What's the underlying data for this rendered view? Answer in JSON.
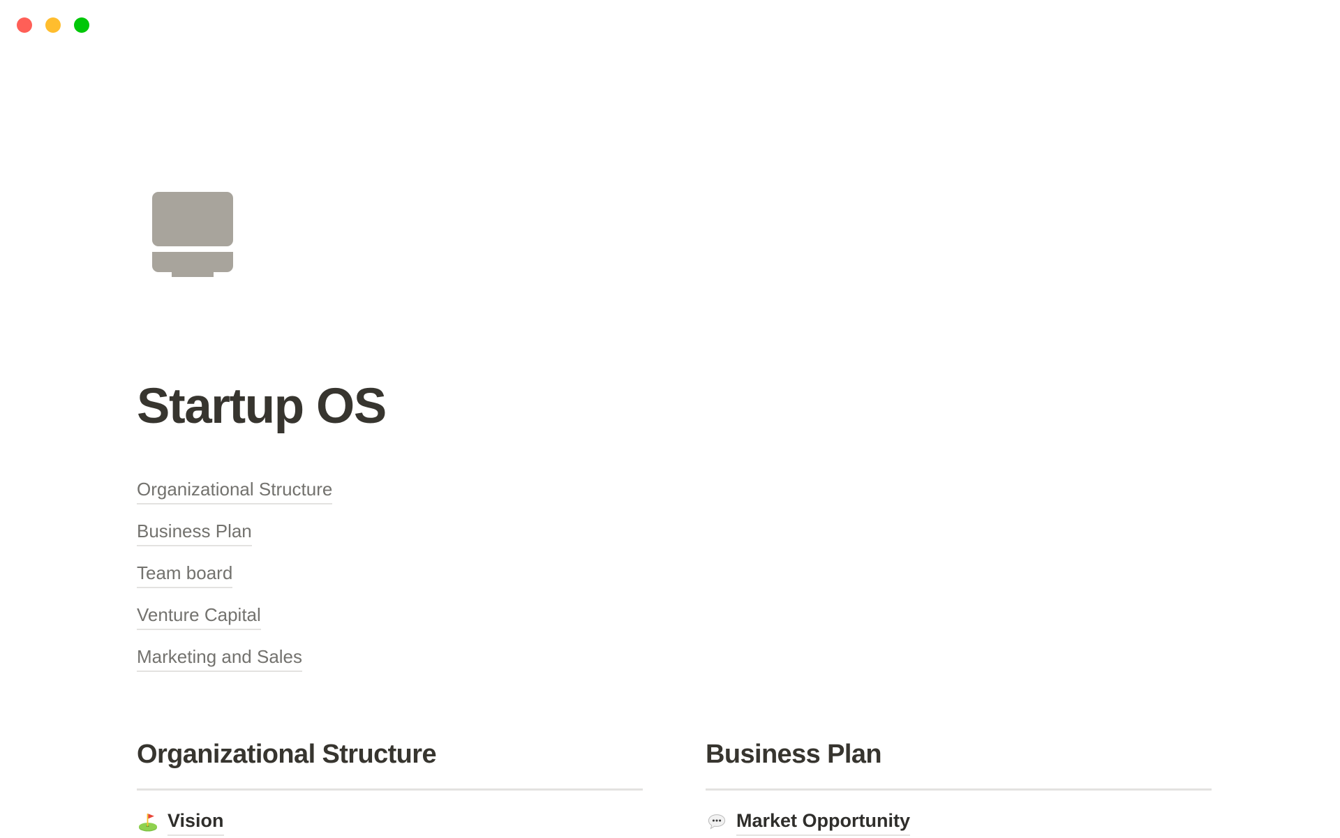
{
  "window": {
    "controls": [
      {
        "name": "close",
        "label": "Close",
        "color": "#ff5f57"
      },
      {
        "name": "minimize",
        "label": "Minimize",
        "color": "#ffbd2e"
      },
      {
        "name": "maximize",
        "label": "Maximize",
        "color": "#00c708"
      }
    ]
  },
  "page": {
    "icon": "desktop-computer-icon",
    "icon_color": "#a8a49c",
    "title": "Startup OS",
    "title_color": "#37352f"
  },
  "links": [
    {
      "label": "Organizational Structure"
    },
    {
      "label": "Business Plan"
    },
    {
      "label": "Team board"
    },
    {
      "label": "Venture Capital"
    },
    {
      "label": "Marketing and Sales"
    }
  ],
  "columns": [
    {
      "heading": "Organizational Structure",
      "items": [
        {
          "emoji": "golf-flag-in-hole-emoji",
          "label": "Vision"
        }
      ]
    },
    {
      "heading": "Business Plan",
      "items": [
        {
          "emoji": "speech-balloon-emoji",
          "label": "Market Opportunity"
        }
      ]
    }
  ],
  "colors": {
    "background": "#ffffff",
    "text_primary": "#37352f",
    "text_secondary": "#73726e",
    "divider": "#e3e2e0"
  }
}
